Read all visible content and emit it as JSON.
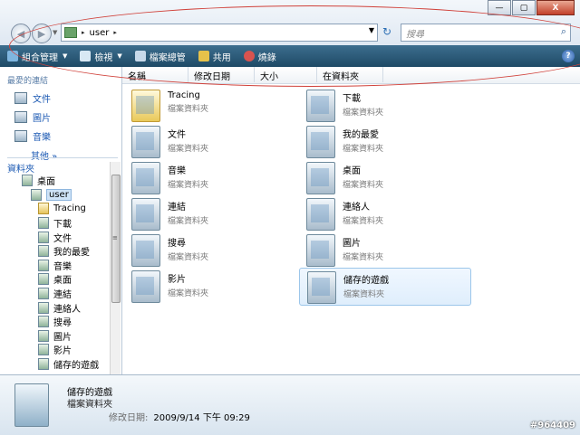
{
  "window": {
    "controls": [
      "—",
      "▢",
      "X"
    ]
  },
  "address": {
    "path": "user",
    "separator": "▸"
  },
  "search": {
    "placeholder": "搜尋"
  },
  "toolbar": {
    "items": [
      {
        "label": "組合管理",
        "has_dropdown": true,
        "icon": "organize-icon"
      },
      {
        "label": "檢視",
        "has_dropdown": true,
        "icon": "views-icon"
      },
      {
        "label": "檔案總管",
        "has_dropdown": false,
        "icon": "explorer-icon"
      },
      {
        "label": "共用",
        "has_dropdown": false,
        "icon": "share-icon"
      },
      {
        "label": "燒錄",
        "has_dropdown": false,
        "icon": "burn-icon"
      }
    ],
    "help": "?"
  },
  "nav": {
    "favorites_header": "最愛的連結",
    "favorites": [
      "文件",
      "圖片",
      "音樂"
    ],
    "more": "其他",
    "folders_header": "資料夾",
    "tree": [
      {
        "label": "桌面",
        "depth": 1,
        "selected": false
      },
      {
        "label": "user",
        "depth": 2,
        "selected": true
      },
      {
        "label": "Tracing",
        "depth": 3,
        "selected": false
      },
      {
        "label": "下載",
        "depth": 3,
        "selected": false
      },
      {
        "label": "文件",
        "depth": 3,
        "selected": false
      },
      {
        "label": "我的最愛",
        "depth": 3,
        "selected": false
      },
      {
        "label": "音樂",
        "depth": 3,
        "selected": false
      },
      {
        "label": "桌面",
        "depth": 3,
        "selected": false
      },
      {
        "label": "連結",
        "depth": 3,
        "selected": false
      },
      {
        "label": "連絡人",
        "depth": 3,
        "selected": false
      },
      {
        "label": "搜尋",
        "depth": 3,
        "selected": false
      },
      {
        "label": "圖片",
        "depth": 3,
        "selected": false
      },
      {
        "label": "影片",
        "depth": 3,
        "selected": false
      },
      {
        "label": "儲存的遊戲",
        "depth": 3,
        "selected": false
      }
    ]
  },
  "columns": [
    "名稱",
    "修改日期",
    "大小",
    "在資料夾"
  ],
  "items": [
    {
      "name": "Tracing",
      "type": "檔案資料夾",
      "icon": "folder-icon",
      "selected": false
    },
    {
      "name": "下載",
      "type": "檔案資料夾",
      "icon": "downloads-folder-icon",
      "selected": false
    },
    {
      "name": "文件",
      "type": "檔案資料夾",
      "icon": "documents-folder-icon",
      "selected": false
    },
    {
      "name": "我的最愛",
      "type": "檔案資料夾",
      "icon": "favorites-folder-icon",
      "selected": false
    },
    {
      "name": "音樂",
      "type": "檔案資料夾",
      "icon": "music-folder-icon",
      "selected": false
    },
    {
      "name": "桌面",
      "type": "檔案資料夾",
      "icon": "desktop-folder-icon",
      "selected": false
    },
    {
      "name": "連結",
      "type": "檔案資料夾",
      "icon": "links-folder-icon",
      "selected": false
    },
    {
      "name": "連絡人",
      "type": "檔案資料夾",
      "icon": "contacts-folder-icon",
      "selected": false
    },
    {
      "name": "搜尋",
      "type": "檔案資料夾",
      "icon": "searches-folder-icon",
      "selected": false
    },
    {
      "name": "圖片",
      "type": "檔案資料夾",
      "icon": "pictures-folder-icon",
      "selected": false
    },
    {
      "name": "影片",
      "type": "檔案資料夾",
      "icon": "videos-folder-icon",
      "selected": false
    },
    {
      "name": "儲存的遊戲",
      "type": "檔案資料夾",
      "icon": "saved-games-folder-icon",
      "selected": true
    }
  ],
  "details": {
    "name": "儲存的遊戲",
    "type": "檔案資料夾",
    "modified_label": "修改日期:",
    "modified_value": "2009/9/14 下午 09:29"
  },
  "watermark": "#964409",
  "colors": {
    "toolbar": "#2a5a78",
    "link": "#1b59b3",
    "annotation": "#d0413a"
  }
}
